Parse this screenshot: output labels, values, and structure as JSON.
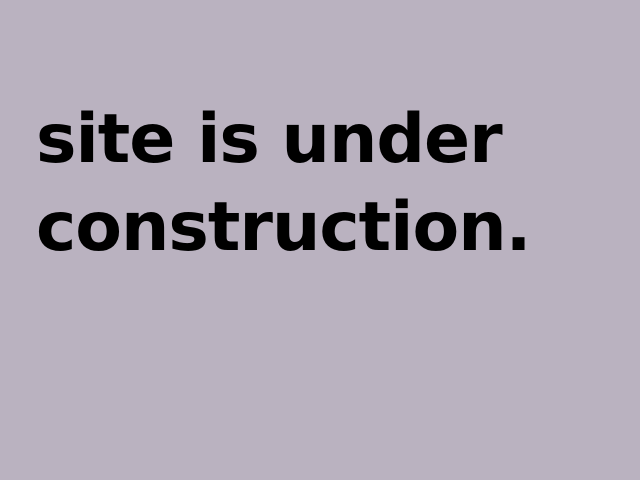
{
  "page": {
    "background_color": "#bab2c0",
    "text_color": "#000000",
    "message_lines": [
      "site is under",
      "construction."
    ]
  }
}
